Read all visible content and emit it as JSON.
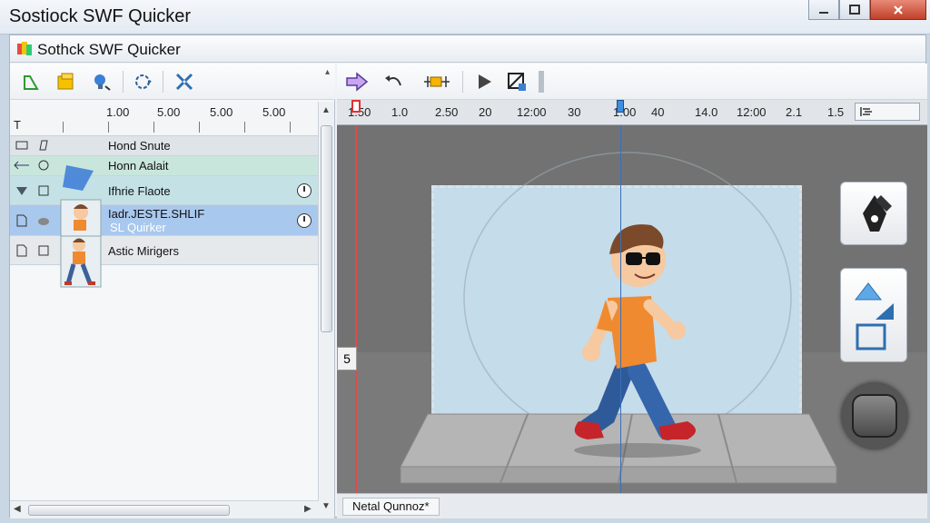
{
  "window": {
    "title": "Sostiock SWF Quicker"
  },
  "app": {
    "title": "Sothck SWF Quicker"
  },
  "left_toolbar": {
    "icons": [
      "new-shape-icon",
      "folder-icon",
      "bulb-icon",
      "motion-path-icon",
      "scissors-icon"
    ]
  },
  "left_ruler": {
    "marker": "T",
    "labels": [
      "1.00",
      "5.00",
      "5.00",
      "5.00"
    ]
  },
  "layers": [
    {
      "name": "Hond Snute"
    },
    {
      "name": "Honn Aalait"
    },
    {
      "name": "Ifhrie Flaote"
    },
    {
      "name": "Iadr.JESTE.SHLIF",
      "subname": "SL Quirker"
    },
    {
      "name": "Astic Mirigers"
    }
  ],
  "right_ruler": {
    "labels": [
      "1:50",
      "1.0",
      "2.50",
      "20",
      "12:00",
      "30",
      "1:00",
      "40",
      "14.0",
      "12:00",
      "2.1",
      "1.5"
    ]
  },
  "frame_indicator": "5",
  "status": {
    "tab_label": "Netal  Qunnoz*"
  },
  "colors": {
    "accent": "#2e6fb6",
    "stage": "#6a6a6a",
    "canvas": "#c5dcea",
    "layer_selected": "#a9c8ee"
  }
}
